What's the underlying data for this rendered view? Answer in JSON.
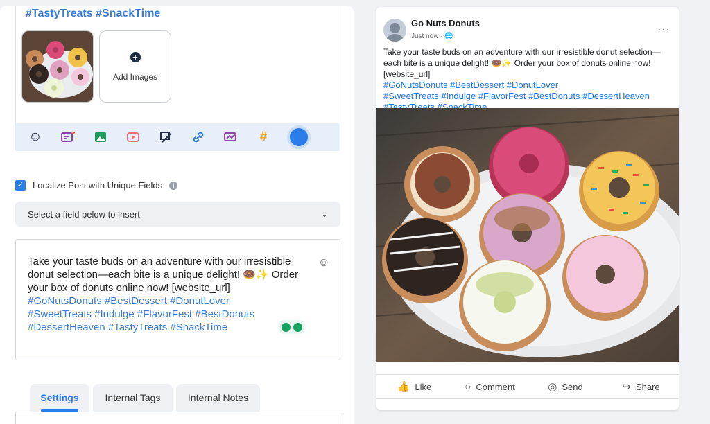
{
  "composer": {
    "hashtag_line": "#TastyTreats #SnackTime",
    "add_images_label": "Add Images",
    "toolbar_icons": [
      "emoji-icon",
      "template-icon",
      "image-icon",
      "video-icon",
      "crop-icon",
      "link-icon",
      "chart-icon",
      "hashtag-icon",
      "ai-assistant-icon"
    ],
    "hashtag_symbol": "#",
    "localize_label": "Localize Post with Unique Fields",
    "localize_checked": true,
    "field_select_placeholder": "Select a field below to insert",
    "post_text_intro": "Take your taste buds on an adventure with our irresistible donut selection—each bite is a unique delight! 🍩✨ Order your box of donuts online now! [website_url]",
    "post_text_tags_1": "#GoNutsDonuts #BestDessert #DonutLover",
    "post_text_tags_2": "#SweetTreats #Indulge #FlavorFest #BestDonuts",
    "post_text_tags_3": "#DessertHeaven #TastyTreats #SnackTime",
    "tabs": [
      {
        "label": "Settings",
        "active": true
      },
      {
        "label": "Internal Tags",
        "active": false
      },
      {
        "label": "Internal Notes",
        "active": false
      }
    ]
  },
  "preview": {
    "page_name": "Go Nuts Donuts",
    "post_time": "Just now · 🌐",
    "more_label": "···",
    "caption": "Take your taste buds on an adventure with our irresistible donut selection—each bite is a unique delight! 🍩✨ Order your box of donuts online now! [website_url]",
    "caption_tags_1": "#GoNutsDonuts #BestDessert #DonutLover",
    "caption_tags_2": "#SweetTreats #Indulge #FlavorFest #BestDonuts #DessertHeaven",
    "caption_tags_3": "#TastyTreats #SnackTime",
    "actions": [
      {
        "label": "Like",
        "icon": "like-icon"
      },
      {
        "label": "Comment",
        "icon": "comment-icon"
      },
      {
        "label": "Send",
        "icon": "send-icon"
      },
      {
        "label": "Share",
        "icon": "share-icon"
      }
    ]
  },
  "colors": {
    "accent": "#2b7de9",
    "hashtag": "#3a7bd5",
    "facebook_link": "#1877f2",
    "toolbar_bg": "#e7effb"
  }
}
